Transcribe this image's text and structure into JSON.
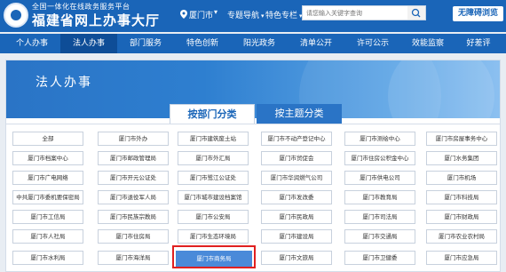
{
  "header": {
    "subtitle": "全国一体化在线政务服务平台",
    "title": "福建省网上办事大厅",
    "location": "厦门市",
    "nav": [
      {
        "label": "专题导航"
      },
      {
        "label": "特色专栏"
      }
    ],
    "search_placeholder": "请您输入关键字查询",
    "accessibility_label": "无障碍浏览"
  },
  "mainnav": {
    "items": [
      {
        "label": "个人办事"
      },
      {
        "label": "法人办事"
      },
      {
        "label": "部门服务"
      },
      {
        "label": "特色创新"
      },
      {
        "label": "阳光政务"
      },
      {
        "label": "清单公开"
      },
      {
        "label": "许可公示"
      },
      {
        "label": "效能监察"
      },
      {
        "label": "好差评"
      }
    ],
    "active_index": 1
  },
  "page": {
    "banner_title": "法人办事",
    "tabs": [
      {
        "label": "按部门分类"
      },
      {
        "label": "按主题分类"
      }
    ],
    "active_tab": 0
  },
  "departments": [
    [
      "全部",
      "厦门市外办",
      "厦门市建筑废土站",
      "厦门市不动产登记中心",
      "厦门市测绘中心",
      "厦门市房屋事务中心"
    ],
    [
      "厦门市档案中心",
      "厦门市邮政管理局",
      "厦门市外汇局",
      "厦门市贸促会",
      "厦门市住房公积金中心",
      "厦门水务集团"
    ],
    [
      "厦门市广电网络",
      "厦门市开元公证处",
      "厦门市鹭江公证处",
      "厦门市华润燃气公司",
      "厦门市供电公司",
      "厦门市机场"
    ],
    [
      "中共厦门市委机要保密局",
      "厦门市退役军人局",
      "厦门市城市建设档案馆",
      "厦门市发改委",
      "厦门市教育局",
      "厦门市科技局"
    ],
    [
      "厦门市工信局",
      "厦门市民族宗教局",
      "厦门市公安局",
      "厦门市民政局",
      "厦门市司法局",
      "厦门市财政局"
    ],
    [
      "厦门市人社局",
      "厦门市住房局",
      "厦门市生态环境局",
      "厦门市建设局",
      "厦门市交通局",
      "厦门市农业农村局"
    ],
    [
      "厦门市水利局",
      "厦门市海洋局",
      "厦门市商务局",
      "厦门市文旅局",
      "厦门市卫健委",
      "厦门市应急局"
    ]
  ],
  "selected_department": "厦门市商务局",
  "colors": {
    "header_blue": "#1a65b8",
    "selected_cell": "#4a8ad9",
    "highlight_box": "#e02020"
  }
}
